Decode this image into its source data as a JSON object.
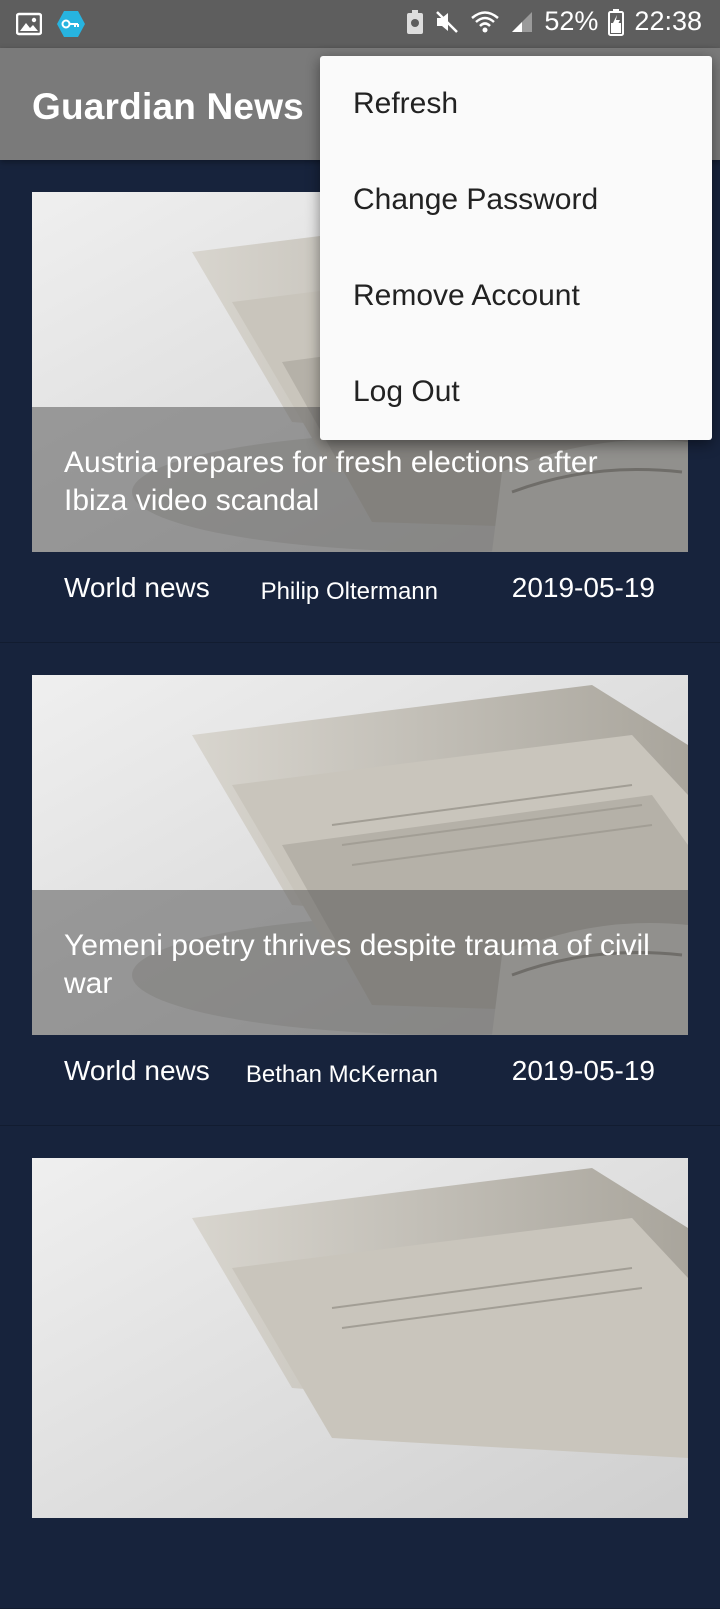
{
  "status_bar": {
    "battery": "52%",
    "time": "22:38",
    "icons": [
      "image-icon",
      "vpn-key-icon",
      "battery-saver-icon",
      "mute-icon",
      "wifi-icon",
      "signal-icon",
      "battery-icon"
    ]
  },
  "app": {
    "title": "Guardian News"
  },
  "menu": {
    "items": [
      {
        "label": "Refresh"
      },
      {
        "label": "Change Password"
      },
      {
        "label": "Remove Account"
      },
      {
        "label": "Log Out"
      }
    ]
  },
  "articles": [
    {
      "headline": "Austria prepares for fresh elections after Ibiza video scandal",
      "section": "World news",
      "author": "Philip Oltermann",
      "date": "2019-05-19"
    },
    {
      "headline": "Yemeni poetry thrives despite trauma of civil war",
      "section": "World news",
      "author": "Bethan McKernan",
      "date": "2019-05-19"
    },
    {
      "headline": "",
      "section": "",
      "author": "",
      "date": ""
    }
  ]
}
